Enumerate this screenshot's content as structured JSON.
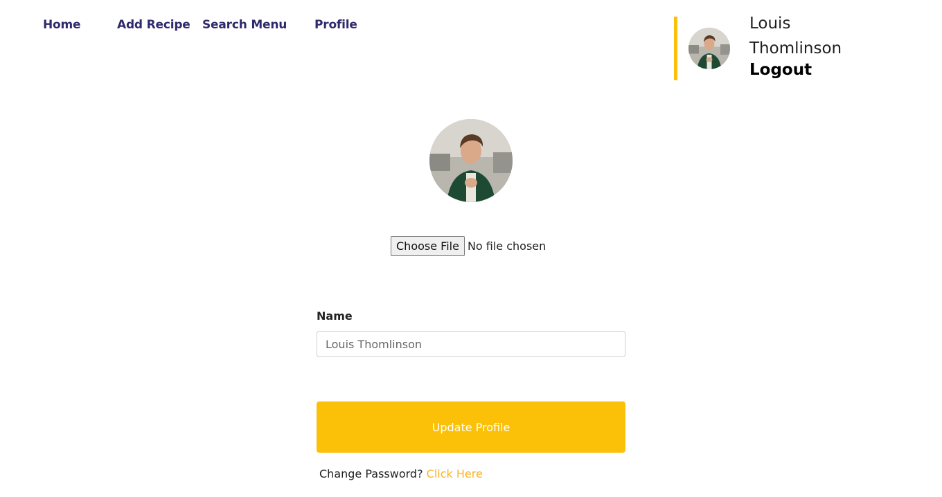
{
  "nav": {
    "items": [
      {
        "label": "Home"
      },
      {
        "label": "Add Recipe"
      },
      {
        "label": "Search Menu"
      },
      {
        "label": "Profile"
      }
    ]
  },
  "user": {
    "name": "Louis Thomlinson",
    "logout_label": "Logout",
    "avatar_icon": "user-avatar-photo"
  },
  "profile": {
    "avatar_icon": "profile-photo",
    "file_input": {
      "button_label": "Choose File",
      "status": "No file chosen"
    },
    "name_label": "Name",
    "name_value": "Louis Thomlinson",
    "update_label": "Update Profile",
    "change_password_text": "Change Password?",
    "change_password_link": "Click Here"
  },
  "colors": {
    "accent": "#fbc108",
    "nav_text": "#2e2a6b",
    "link": "#fbb324"
  }
}
